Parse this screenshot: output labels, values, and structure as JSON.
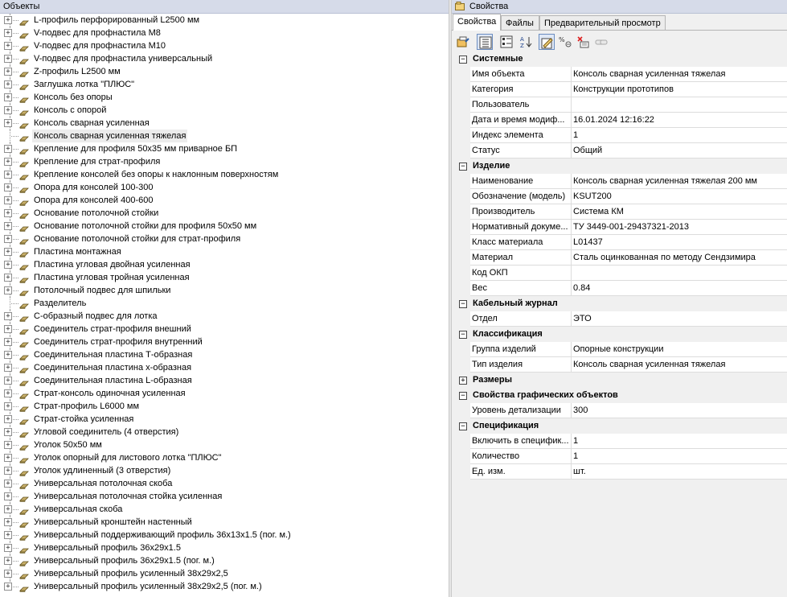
{
  "left_panel": {
    "title": "Объекты",
    "items": [
      {
        "label": "L-профиль перфорированный L2500 мм",
        "expandable": true,
        "selected": false
      },
      {
        "label": "V-подвес для профнастила M8",
        "expandable": true,
        "selected": false
      },
      {
        "label": "V-подвес для профнастила M10",
        "expandable": true,
        "selected": false
      },
      {
        "label": "V-подвес для профнастила универсальный",
        "expandable": true,
        "selected": false
      },
      {
        "label": "Z-профиль L2500 мм",
        "expandable": true,
        "selected": false
      },
      {
        "label": "Заглушка лотка \"ПЛЮС\"",
        "expandable": true,
        "selected": false
      },
      {
        "label": "Консоль без опоры",
        "expandable": true,
        "selected": false
      },
      {
        "label": "Консоль с опорой",
        "expandable": true,
        "selected": false
      },
      {
        "label": "Консоль сварная усиленная",
        "expandable": true,
        "selected": false
      },
      {
        "label": "Консоль сварная усиленная тяжелая",
        "expandable": false,
        "selected": true
      },
      {
        "label": "Крепление для профиля 50x35 мм приварное БП",
        "expandable": true,
        "selected": false
      },
      {
        "label": "Крепление для страт-профиля",
        "expandable": true,
        "selected": false
      },
      {
        "label": "Крепление консолей без опоры к наклонным поверхностям",
        "expandable": true,
        "selected": false
      },
      {
        "label": "Опора для консолей 100-300",
        "expandable": true,
        "selected": false
      },
      {
        "label": "Опора для консолей 400-600",
        "expandable": true,
        "selected": false
      },
      {
        "label": "Основание потолочной стойки",
        "expandable": true,
        "selected": false
      },
      {
        "label": "Основание потолочной стойки для профиля 50x50 мм",
        "expandable": true,
        "selected": false
      },
      {
        "label": "Основание потолочной стойки для страт-профиля",
        "expandable": true,
        "selected": false
      },
      {
        "label": "Пластина монтажная",
        "expandable": true,
        "selected": false
      },
      {
        "label": "Пластина угловая двойная усиленная",
        "expandable": true,
        "selected": false
      },
      {
        "label": "Пластина угловая тройная усиленная",
        "expandable": true,
        "selected": false
      },
      {
        "label": "Потолочный подвес для шпильки",
        "expandable": true,
        "selected": false
      },
      {
        "label": "Разделитель",
        "expandable": false,
        "selected": false
      },
      {
        "label": "С-образный подвес для лотка",
        "expandable": true,
        "selected": false
      },
      {
        "label": "Соединитель страт-профиля внешний",
        "expandable": true,
        "selected": false
      },
      {
        "label": "Соединитель страт-профиля внутренний",
        "expandable": true,
        "selected": false
      },
      {
        "label": "Соединительная пластина Т-образная",
        "expandable": true,
        "selected": false
      },
      {
        "label": "Соединительная пластина х-образная",
        "expandable": true,
        "selected": false
      },
      {
        "label": "Соединительная пластина L-образная",
        "expandable": true,
        "selected": false
      },
      {
        "label": "Страт-консоль одиночная усиленная",
        "expandable": true,
        "selected": false
      },
      {
        "label": "Страт-профиль L6000 мм",
        "expandable": true,
        "selected": false
      },
      {
        "label": "Страт-стойка усиленная",
        "expandable": true,
        "selected": false
      },
      {
        "label": "Угловой соединитель (4 отверстия)",
        "expandable": true,
        "selected": false
      },
      {
        "label": "Уголок 50x50 мм",
        "expandable": true,
        "selected": false
      },
      {
        "label": "Уголок опорный для листового лотка \"ПЛЮС\"",
        "expandable": true,
        "selected": false
      },
      {
        "label": "Уголок удлиненный (3 отверстия)",
        "expandable": true,
        "selected": false
      },
      {
        "label": "Универсальная потолочная скоба",
        "expandable": true,
        "selected": false
      },
      {
        "label": "Универсальная потолочная стойка усиленная",
        "expandable": true,
        "selected": false
      },
      {
        "label": "Универсальная скоба",
        "expandable": true,
        "selected": false
      },
      {
        "label": "Универсальный кронштейн настенный",
        "expandable": true,
        "selected": false
      },
      {
        "label": "Универсальный поддерживающий профиль 36x13x1.5 (пог. м.)",
        "expandable": true,
        "selected": false
      },
      {
        "label": "Универсальный профиль 36x29x1.5",
        "expandable": true,
        "selected": false
      },
      {
        "label": "Универсальный профиль 36x29x1.5 (пог. м.)",
        "expandable": true,
        "selected": false
      },
      {
        "label": "Универсальный профиль усиленный 38x29x2,5",
        "expandable": true,
        "selected": false
      },
      {
        "label": "Универсальный профиль усиленный 38x29x2,5 (пог. м.)",
        "expandable": true,
        "selected": false
      }
    ]
  },
  "right_panel": {
    "title": "Свойства",
    "tabs": [
      "Свойства",
      "Файлы",
      "Предварительный просмотр"
    ],
    "active_tab": "Свойства",
    "toolbar_icons": [
      "properties-icon",
      "categorized-icon",
      "grouped-icon",
      "sort-az-icon",
      "edit-icon",
      "formula-icon",
      "delete-icon",
      "link-icon"
    ],
    "categories": [
      {
        "name": "Системные",
        "expanded": true,
        "rows": [
          {
            "name": "Имя объекта",
            "value": "Консоль сварная усиленная тяжелая"
          },
          {
            "name": "Категория",
            "value": "Конструкции прототипов"
          },
          {
            "name": "Пользователь",
            "value": ""
          },
          {
            "name": "Дата и время модиф...",
            "value": "16.01.2024 12:16:22"
          },
          {
            "name": "Индекс элемента",
            "value": "1"
          },
          {
            "name": "Статус",
            "value": "Общий"
          }
        ]
      },
      {
        "name": "Изделие",
        "expanded": true,
        "rows": [
          {
            "name": "Наименование",
            "value": "Консоль сварная усиленная тяжелая 200 мм"
          },
          {
            "name": "Обозначение (модель)",
            "value": "KSUT200"
          },
          {
            "name": "Производитель",
            "value": "Система КМ"
          },
          {
            "name": "Нормативный докуме...",
            "value": "ТУ 3449-001-29437321-2013"
          },
          {
            "name": "Класс материала",
            "value": "L01437"
          },
          {
            "name": "Материал",
            "value": "Сталь оцинкованная по методу Сендзимира"
          },
          {
            "name": "Код ОКП",
            "value": ""
          },
          {
            "name": "Вес",
            "value": "0.84"
          }
        ]
      },
      {
        "name": "Кабельный журнал",
        "expanded": true,
        "rows": [
          {
            "name": "Отдел",
            "value": "ЭТО"
          }
        ]
      },
      {
        "name": "Классификация",
        "expanded": true,
        "rows": [
          {
            "name": "Группа изделий",
            "value": "Опорные конструкции"
          },
          {
            "name": "Тип изделия",
            "value": "Консоль сварная усиленная тяжелая"
          }
        ]
      },
      {
        "name": "Размеры",
        "expanded": false,
        "rows": []
      },
      {
        "name": "Свойства графических объектов",
        "expanded": true,
        "rows": [
          {
            "name": "Уровень детализации",
            "value": "300"
          }
        ]
      },
      {
        "name": "Спецификация",
        "expanded": true,
        "rows": [
          {
            "name": "Включить в специфик...",
            "value": "1"
          },
          {
            "name": "Количество",
            "value": "1"
          },
          {
            "name": "Ед. изм.",
            "value": "шт."
          }
        ]
      }
    ]
  }
}
